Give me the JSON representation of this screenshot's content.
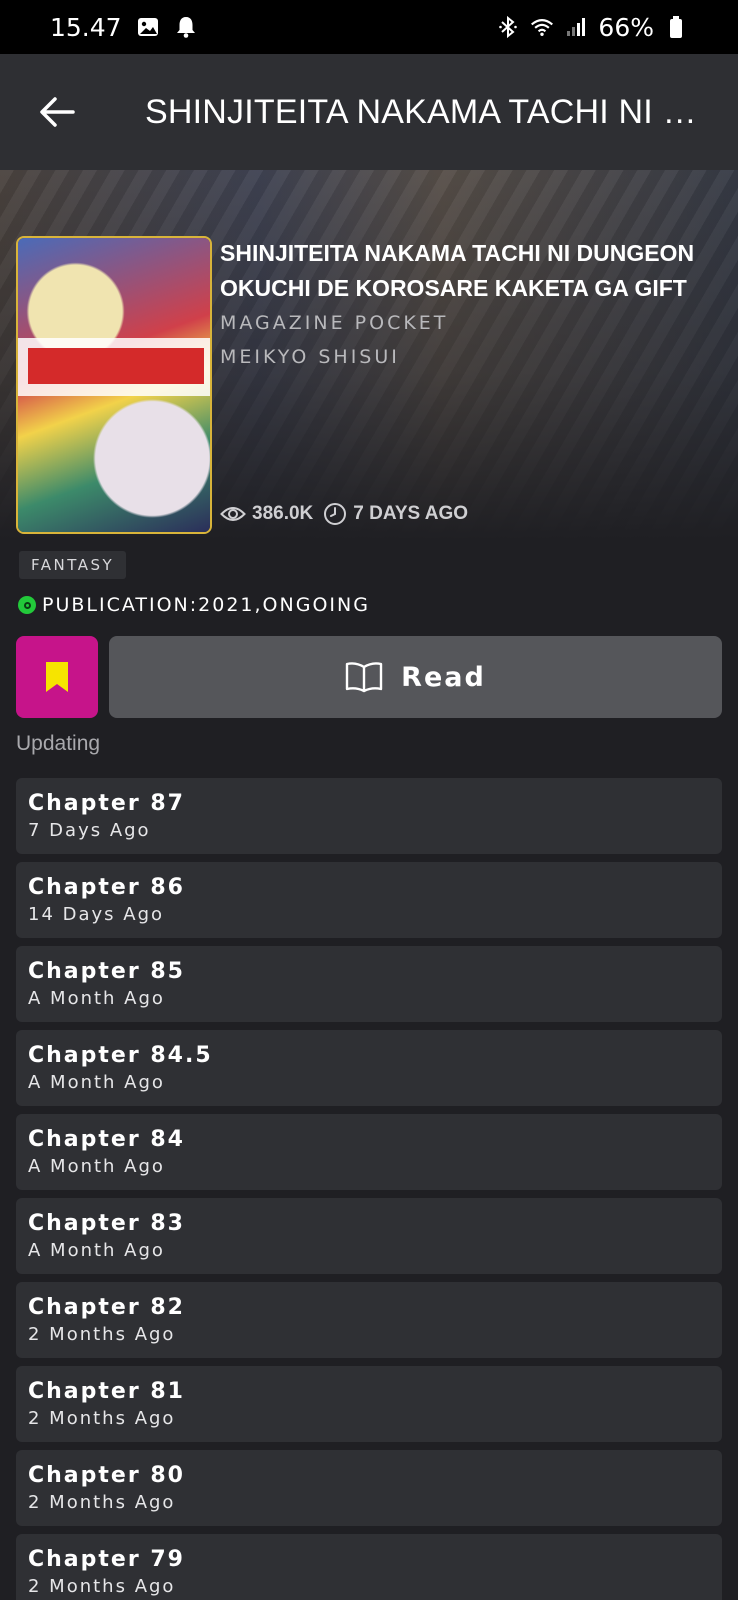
{
  "status_bar": {
    "time": "15.47",
    "battery": "66%"
  },
  "app_bar": {
    "title": "SHINJITEITA NAKAMA TACHI NI DUNGEON OKUCHI DE KOROSARE KAKETA GA GIFT"
  },
  "manga": {
    "title": "SHINJITEITA NAKAMA TACHI NI DUNGEON OKUCHI DE KOROSARE KAKETA GA GIFT",
    "publisher": "MAGAZINE POCKET",
    "author": "MEIKYO SHISUI",
    "views": "386.0K",
    "updated": "7 DAYS AGO",
    "genre": "FANTASY",
    "publication": "PUBLICATION:2021,ONGOING",
    "status_color": "#22c93a"
  },
  "actions": {
    "read_label": "Read",
    "bookmark_color": "#c6148a"
  },
  "updating_label": "Updating",
  "chapters": [
    {
      "name": "Chapter 87",
      "date": "7 Days Ago"
    },
    {
      "name": "Chapter 86",
      "date": "14 Days Ago"
    },
    {
      "name": "Chapter 85",
      "date": "A Month Ago"
    },
    {
      "name": "Chapter 84.5",
      "date": "A Month Ago"
    },
    {
      "name": "Chapter 84",
      "date": "A Month Ago"
    },
    {
      "name": "Chapter 83",
      "date": "A Month Ago"
    },
    {
      "name": "Chapter 82",
      "date": "2 Months Ago"
    },
    {
      "name": "Chapter 81",
      "date": "2 Months Ago"
    },
    {
      "name": "Chapter 80",
      "date": "2 Months Ago"
    },
    {
      "name": "Chapter 79",
      "date": "2 Months Ago"
    }
  ]
}
